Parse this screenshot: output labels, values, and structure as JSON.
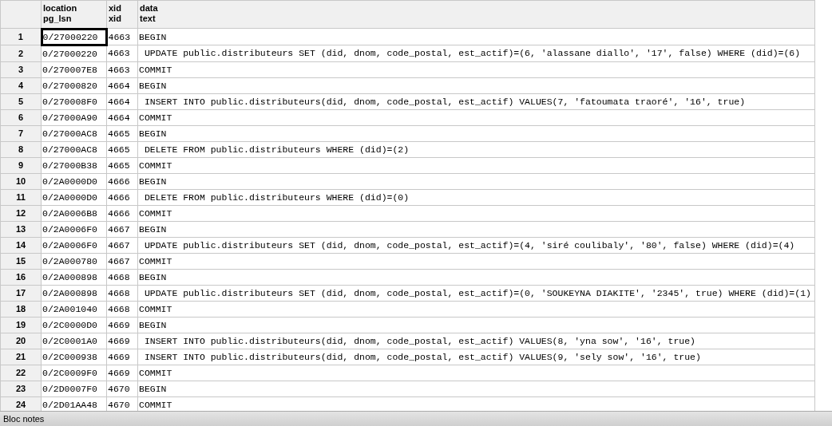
{
  "table": {
    "columns": [
      {
        "name": "location",
        "type": "pg_lsn"
      },
      {
        "name": "xid",
        "type": "xid"
      },
      {
        "name": "data",
        "type": "text"
      }
    ],
    "rows": [
      {
        "number": "1",
        "location": "0/27000220",
        "xid": "4663",
        "data": "BEGIN",
        "selected": true
      },
      {
        "number": "2",
        "location": "0/27000220",
        "xid": "4663",
        "data": " UPDATE public.distributeurs SET (did, dnom, code_postal, est_actif)=(6, 'alassane diallo', '17', false) WHERE (did)=(6)",
        "selected": false
      },
      {
        "number": "3",
        "location": "0/270007E8",
        "xid": "4663",
        "data": "COMMIT",
        "selected": false
      },
      {
        "number": "4",
        "location": "0/27000820",
        "xid": "4664",
        "data": "BEGIN",
        "selected": false
      },
      {
        "number": "5",
        "location": "0/270008F0",
        "xid": "4664",
        "data": " INSERT INTO public.distributeurs(did, dnom, code_postal, est_actif) VALUES(7, 'fatoumata traoré', '16', true)",
        "selected": false
      },
      {
        "number": "6",
        "location": "0/27000A90",
        "xid": "4664",
        "data": "COMMIT",
        "selected": false
      },
      {
        "number": "7",
        "location": "0/27000AC8",
        "xid": "4665",
        "data": "BEGIN",
        "selected": false
      },
      {
        "number": "8",
        "location": "0/27000AC8",
        "xid": "4665",
        "data": " DELETE FROM public.distributeurs WHERE (did)=(2)",
        "selected": false
      },
      {
        "number": "9",
        "location": "0/27000B38",
        "xid": "4665",
        "data": "COMMIT",
        "selected": false
      },
      {
        "number": "10",
        "location": "0/2A0000D0",
        "xid": "4666",
        "data": "BEGIN",
        "selected": false
      },
      {
        "number": "11",
        "location": "0/2A0000D0",
        "xid": "4666",
        "data": " DELETE FROM public.distributeurs WHERE (did)=(0)",
        "selected": false
      },
      {
        "number": "12",
        "location": "0/2A0006B8",
        "xid": "4666",
        "data": "COMMIT",
        "selected": false
      },
      {
        "number": "13",
        "location": "0/2A0006F0",
        "xid": "4667",
        "data": "BEGIN",
        "selected": false
      },
      {
        "number": "14",
        "location": "0/2A0006F0",
        "xid": "4667",
        "data": " UPDATE public.distributeurs SET (did, dnom, code_postal, est_actif)=(4, 'siré coulibaly', '80', false) WHERE (did)=(4)",
        "selected": false
      },
      {
        "number": "15",
        "location": "0/2A000780",
        "xid": "4667",
        "data": "COMMIT",
        "selected": false
      },
      {
        "number": "16",
        "location": "0/2A000898",
        "xid": "4668",
        "data": "BEGIN",
        "selected": false
      },
      {
        "number": "17",
        "location": "0/2A000898",
        "xid": "4668",
        "data": " UPDATE public.distributeurs SET (did, dnom, code_postal, est_actif)=(0, 'SOUKEYNA DIAKITE', '2345', true) WHERE (did)=(1)",
        "selected": false
      },
      {
        "number": "18",
        "location": "0/2A001040",
        "xid": "4668",
        "data": "COMMIT",
        "selected": false
      },
      {
        "number": "19",
        "location": "0/2C0000D0",
        "xid": "4669",
        "data": "BEGIN",
        "selected": false
      },
      {
        "number": "20",
        "location": "0/2C0001A0",
        "xid": "4669",
        "data": " INSERT INTO public.distributeurs(did, dnom, code_postal, est_actif) VALUES(8, 'yna sow', '16', true)",
        "selected": false
      },
      {
        "number": "21",
        "location": "0/2C000938",
        "xid": "4669",
        "data": " INSERT INTO public.distributeurs(did, dnom, code_postal, est_actif) VALUES(9, 'sely sow', '16', true)",
        "selected": false
      },
      {
        "number": "22",
        "location": "0/2C0009F0",
        "xid": "4669",
        "data": "COMMIT",
        "selected": false
      },
      {
        "number": "23",
        "location": "0/2D0007F0",
        "xid": "4670",
        "data": "BEGIN",
        "selected": false
      },
      {
        "number": "24",
        "location": "0/2D01AA48",
        "xid": "4670",
        "data": "COMMIT",
        "selected": false
      }
    ]
  },
  "status_bar": {
    "text": "Bloc notes"
  }
}
